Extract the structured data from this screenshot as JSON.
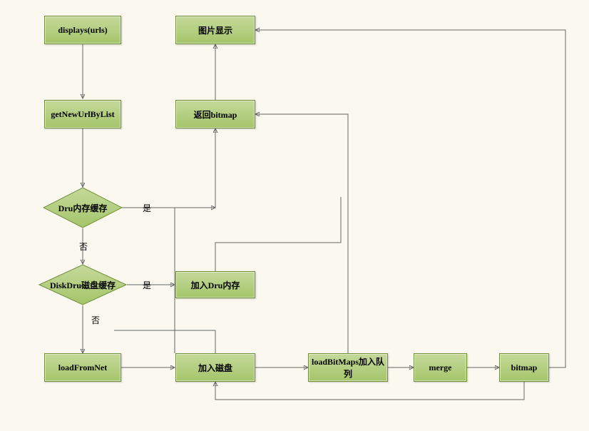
{
  "nodes": {
    "displays": "displays(urls)",
    "getNew": "getNewUrlByList",
    "dru": "Dru内存缓存",
    "diskDru": "DiskDru磁盘缓存",
    "loadNet": "loadFromNet",
    "addDisk": "加入磁盘",
    "addDru": "加入Dru内存",
    "loadBitmaps": "loadBitMaps加入队列",
    "merge": "merge",
    "bitmap": "bitmap",
    "retBitmap": "返回bitmap",
    "show": "图片显示"
  },
  "labels": {
    "yes": "是",
    "no": "否"
  }
}
